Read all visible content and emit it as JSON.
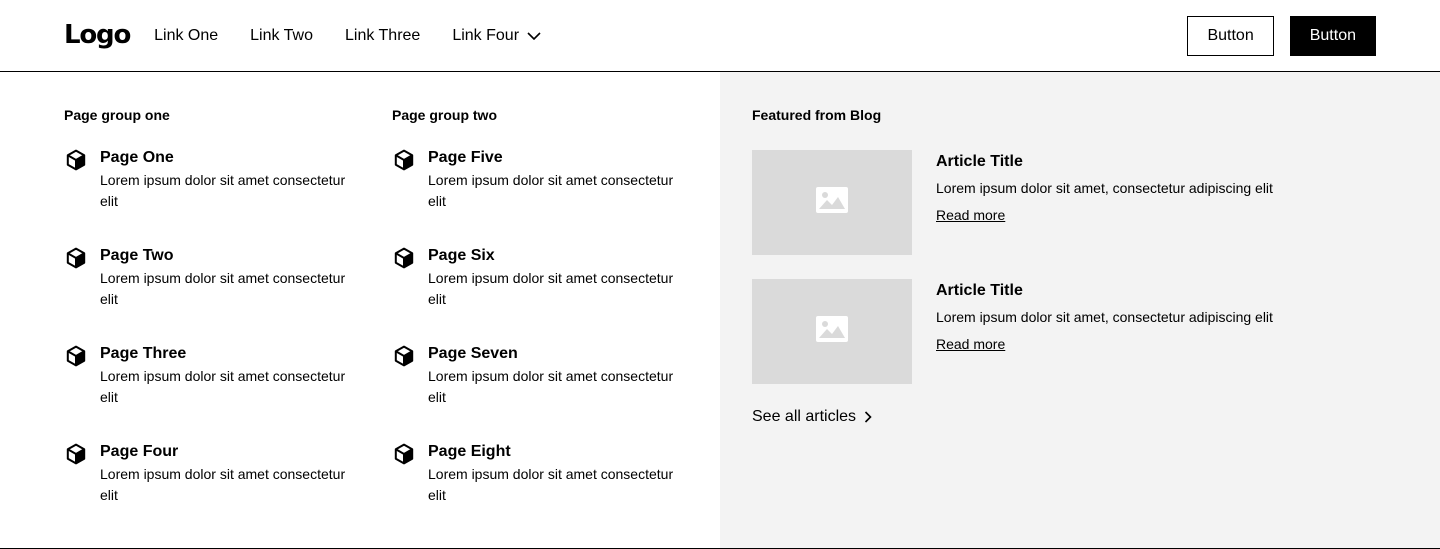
{
  "navbar": {
    "logo": "Logo",
    "links": [
      "Link One",
      "Link Two",
      "Link Three",
      "Link Four"
    ],
    "secondary_button": "Button",
    "primary_button": "Button"
  },
  "menu": {
    "groups": [
      {
        "title": "Page group one",
        "items": [
          {
            "title": "Page One",
            "desc": "Lorem ipsum dolor sit amet consectetur elit"
          },
          {
            "title": "Page Two",
            "desc": "Lorem ipsum dolor sit amet consectetur elit"
          },
          {
            "title": "Page Three",
            "desc": "Lorem ipsum dolor sit amet consectetur elit"
          },
          {
            "title": "Page Four",
            "desc": "Lorem ipsum dolor sit amet consectetur elit"
          }
        ]
      },
      {
        "title": "Page group two",
        "items": [
          {
            "title": "Page Five",
            "desc": "Lorem ipsum dolor sit amet consectetur elit"
          },
          {
            "title": "Page Six",
            "desc": "Lorem ipsum dolor sit amet consectetur elit"
          },
          {
            "title": "Page Seven",
            "desc": "Lorem ipsum dolor sit amet consectetur elit"
          },
          {
            "title": "Page Eight",
            "desc": "Lorem ipsum dolor sit amet consectetur elit"
          }
        ]
      }
    ],
    "blog": {
      "title": "Featured from Blog",
      "articles": [
        {
          "title": "Article Title",
          "desc": "Lorem ipsum dolor sit amet, consectetur adipiscing elit",
          "link": "Read more"
        },
        {
          "title": "Article Title",
          "desc": "Lorem ipsum dolor sit amet, consectetur adipiscing elit",
          "link": "Read more"
        }
      ],
      "see_all": "See all articles"
    }
  },
  "colors": {
    "accent": "#000000",
    "panel_bg": "#f3f3f3",
    "image_placeholder": "#dadada"
  }
}
